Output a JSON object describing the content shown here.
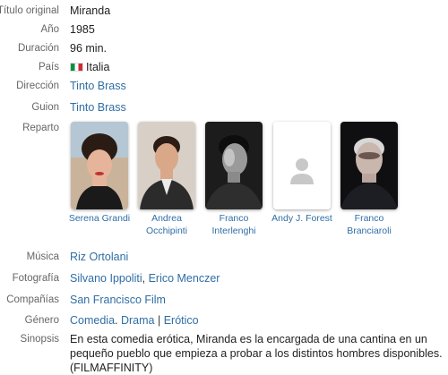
{
  "fields": {
    "titulo": {
      "label": "Título original",
      "value": "Miranda"
    },
    "anio": {
      "label": "Año",
      "value": "1985"
    },
    "duracion": {
      "label": "Duración",
      "value": "96 min."
    },
    "pais": {
      "label": "País",
      "value": "Italia",
      "flag_icon": "italy-flag-icon"
    },
    "direccion": {
      "label": "Dirección",
      "links": [
        "Tinto Brass"
      ]
    },
    "guion": {
      "label": "Guion",
      "links": [
        "Tinto Brass"
      ]
    },
    "reparto": {
      "label": "Reparto"
    },
    "musica": {
      "label": "Música",
      "links": [
        "Riz Ortolani"
      ]
    },
    "fotografia": {
      "label": "Fotografía",
      "links": [
        "Silvano Ippoliti",
        "Erico Menczer"
      ],
      "separator": ", "
    },
    "companias": {
      "label": "Compañías",
      "links": [
        "San Francisco Film"
      ]
    },
    "genero": {
      "label": "Género",
      "links": [
        "Comedia",
        "Drama",
        "Erótico"
      ],
      "separators": [
        ". ",
        " | "
      ]
    },
    "sinopsis": {
      "label": "Sinopsis",
      "value": "En esta comedia erótica, Miranda es la encargada de una cantina en un pequeño pueblo que empieza a probar a los distintos hombres disponibles. (FILMAFFINITY)"
    }
  },
  "cast": [
    {
      "line1": "Serena Grandi",
      "line2": "",
      "photo": "actor-photo"
    },
    {
      "line1": "Andrea",
      "line2": "Occhipinti",
      "photo": "actor-photo"
    },
    {
      "line1": "Franco",
      "line2": "Interlenghi",
      "photo": "actor-photo"
    },
    {
      "line1": "Andy J. Forest",
      "line2": "",
      "photo": "placeholder-person-icon"
    },
    {
      "line1": "Franco",
      "line2": "Branciaroli",
      "photo": "actor-photo"
    }
  ],
  "colors": {
    "link": "#2f6ea5",
    "label": "#666666",
    "text": "#222222"
  }
}
